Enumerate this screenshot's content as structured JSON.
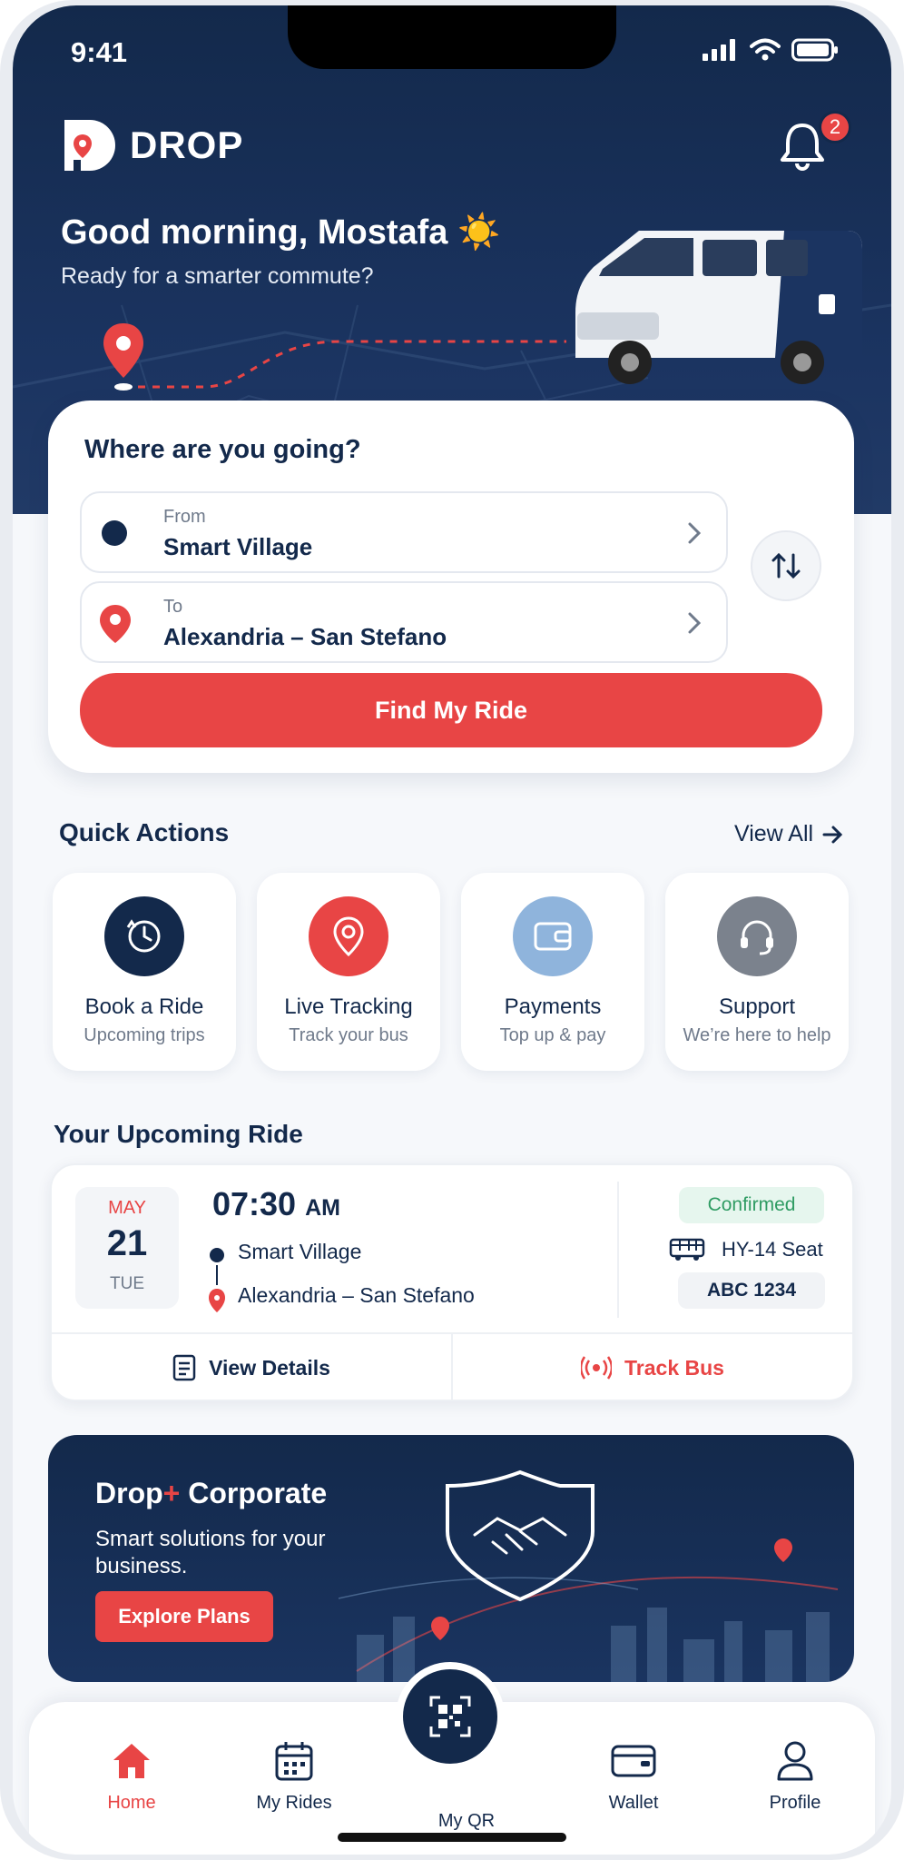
{
  "status": {
    "time": "9:41"
  },
  "brand": {
    "name": "DROP",
    "accent": "#e84545",
    "navy": "#13294b"
  },
  "notifications": {
    "count": "2",
    "icon": "bell-icon"
  },
  "greeting": {
    "title": "Good morning, Mostafa ☀️",
    "subtitle": "Ready for a smarter commute?"
  },
  "search": {
    "title": "Where are you going?",
    "from": {
      "label": "From",
      "value": "Smart Village"
    },
    "to": {
      "label": "To",
      "value": "Alexandria – San Stefano"
    },
    "button": "Find My Ride"
  },
  "quick_actions": {
    "title": "Quick Actions",
    "view_all": "View All",
    "items": [
      {
        "title": "Book a Ride",
        "subtitle": "Upcoming trips",
        "icon": "clock-icon",
        "color": "#13294b"
      },
      {
        "title": "Live Tracking",
        "subtitle": "Track your bus",
        "icon": "location-pin-icon",
        "color": "#e84545"
      },
      {
        "title": "Payments",
        "subtitle": "Top up & pay",
        "icon": "wallet-icon",
        "color": "#8fb4dc"
      },
      {
        "title": "Support",
        "subtitle": "We’re here to help",
        "icon": "headset-icon",
        "color": "#7b828d"
      }
    ]
  },
  "upcoming": {
    "title": "Your Upcoming Ride",
    "month": "MAY",
    "day": "21",
    "weekday": "TUE",
    "time": "07:30",
    "ampm": "AM",
    "from": "Smart Village",
    "to": "Alexandria – San Stefano",
    "status": "Confirmed",
    "vehicle": "HY-14 Seat",
    "plate": "ABC 1234",
    "view_details": "View Details",
    "track_bus": "Track Bus"
  },
  "corporate": {
    "title_a": "Drop",
    "title_plus": "+",
    "title_b": " Corporate",
    "subtitle": "Smart solutions for your business.",
    "button": "Explore Plans"
  },
  "tabs": [
    {
      "label": "Home",
      "icon": "home-icon",
      "active": true
    },
    {
      "label": "My Rides",
      "icon": "calendar-icon"
    },
    {
      "label": "My QR",
      "icon": "qr-code-icon"
    },
    {
      "label": "Wallet",
      "icon": "wallet-icon"
    },
    {
      "label": "Profile",
      "icon": "user-icon"
    }
  ]
}
